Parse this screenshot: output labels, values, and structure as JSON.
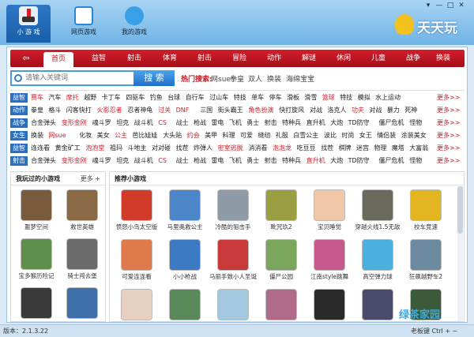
{
  "titlebar": {
    "tabs": [
      {
        "label": "小 游 戏",
        "icon": "joystick-icon",
        "color": "#2c77c4"
      },
      {
        "label": "网页游戏",
        "icon": "tv-icon",
        "color": "#ffffff"
      },
      {
        "label": "我的游戏",
        "icon": "user-icon",
        "color": "#ffffff"
      }
    ],
    "logo_text": "天天玩",
    "win_buttons": [
      "▾",
      "—",
      "□",
      "✕"
    ]
  },
  "nav": {
    "back_label": "⇦",
    "items": [
      "首页",
      "益智",
      "射击",
      "体育",
      "射击",
      "冒险",
      "动作",
      "解谜",
      "休闲",
      "儿童",
      "战争",
      "换装"
    ]
  },
  "search": {
    "placeholder": "请输入关键词",
    "button_label": "搜 索",
    "hot_label": "热门搜索:",
    "hot_words": [
      "网sue",
      "拳皇",
      "双人",
      "换装",
      "海绵宝宝"
    ]
  },
  "categories": [
    {
      "head": "益智",
      "items": [
        [
          "赛车",
          "r"
        ],
        [
          "汽车",
          ""
        ],
        [
          "摩托",
          "r"
        ],
        [
          "越野",
          ""
        ],
        [
          "卡丁车",
          ""
        ],
        [
          "四驱车",
          ""
        ],
        [
          "钓鱼",
          ""
        ],
        [
          "台球",
          ""
        ],
        [
          "自行车",
          ""
        ],
        [
          "过山车",
          ""
        ],
        [
          "特技",
          ""
        ],
        [
          "单车",
          ""
        ],
        [
          "停车",
          ""
        ],
        [
          "滑板",
          ""
        ],
        [
          "滑雪",
          ""
        ],
        [
          "篮球",
          "r"
        ],
        [
          "特技",
          ""
        ],
        [
          "模拟",
          ""
        ],
        [
          "水上运动",
          ""
        ]
      ]
    },
    {
      "head": "动作",
      "items": [
        [
          "拳皇",
          ""
        ],
        [
          "格斗",
          ""
        ],
        [
          "闪客快打",
          ""
        ],
        [
          "火影忍者",
          "r"
        ],
        [
          "忍者神龟",
          ""
        ],
        [
          "过关",
          "r"
        ],
        [
          "DNF",
          "r"
        ],
        [
          "三国",
          ""
        ],
        [
          "街头霸王",
          ""
        ],
        [
          "角色扮演",
          "r"
        ],
        [
          "快打旋风",
          ""
        ],
        [
          "对战",
          ""
        ],
        [
          "洛克人",
          ""
        ],
        [
          "功夫",
          "r"
        ],
        [
          "对战",
          ""
        ],
        [
          "暴力",
          ""
        ],
        [
          "死神",
          ""
        ],
        [
          "英雄",
          ""
        ]
      ]
    },
    {
      "head": "战争",
      "items": [
        [
          "合金弹头",
          ""
        ],
        [
          "变形金刚",
          "r"
        ],
        [
          "魂斗罗",
          ""
        ],
        [
          "坦克",
          ""
        ],
        [
          "战斗机",
          ""
        ],
        [
          "CS",
          "r"
        ],
        [
          "战士",
          ""
        ],
        [
          "枪战",
          ""
        ],
        [
          "雷电",
          ""
        ],
        [
          "飞机",
          ""
        ],
        [
          "勇士",
          ""
        ],
        [
          "射击",
          ""
        ],
        [
          "特种兵",
          ""
        ],
        [
          "直升机",
          ""
        ],
        [
          "大炮",
          ""
        ],
        [
          "TD防守",
          ""
        ],
        [
          "僵尸危机",
          ""
        ],
        [
          "怪物",
          ""
        ],
        [
          "策略",
          ""
        ]
      ]
    },
    {
      "head": "女生",
      "items": [
        [
          "换装",
          ""
        ],
        [
          "网sue",
          "r"
        ],
        [
          "化妆",
          ""
        ],
        [
          "美女",
          ""
        ],
        [
          "公主",
          "r"
        ],
        [
          "芭比娃娃",
          ""
        ],
        [
          "大头贴",
          ""
        ],
        [
          "约会",
          "r"
        ],
        [
          "美甲",
          ""
        ],
        [
          "料理",
          ""
        ],
        [
          "可爱",
          ""
        ],
        [
          "缝纫",
          ""
        ],
        [
          "礼服",
          ""
        ],
        [
          "白雪公主",
          ""
        ],
        [
          "波比",
          ""
        ],
        [
          "时尚",
          ""
        ],
        [
          "女王",
          ""
        ],
        [
          "情侣装",
          ""
        ],
        [
          "涂装美女",
          ""
        ]
      ]
    },
    {
      "head": "益智",
      "items": [
        [
          "连连看",
          ""
        ],
        [
          "黄金矿工",
          ""
        ],
        [
          "泡泡堂",
          "r"
        ],
        [
          "祖玛",
          ""
        ],
        [
          "斗地主",
          ""
        ],
        [
          "对对碰",
          ""
        ],
        [
          "找茬",
          ""
        ],
        [
          "炸弹人",
          ""
        ],
        [
          "密室逃脱",
          "r"
        ],
        [
          "消消看",
          ""
        ],
        [
          "泡泡龙",
          "r"
        ],
        [
          "吃豆豆",
          ""
        ],
        [
          "找茬",
          ""
        ],
        [
          "棋牌",
          ""
        ],
        [
          "迷宫",
          ""
        ],
        [
          "物理",
          ""
        ],
        [
          "魔塔",
          ""
        ],
        [
          "大富翁",
          ""
        ]
      ]
    },
    {
      "head": "射击",
      "items": [
        [
          "合金弹头",
          ""
        ],
        [
          "变形金刚",
          "r"
        ],
        [
          "魂斗罗",
          ""
        ],
        [
          "坦克",
          ""
        ],
        [
          "战斗机",
          ""
        ],
        [
          "CS",
          "r"
        ],
        [
          "战士",
          ""
        ],
        [
          "枪战",
          ""
        ],
        [
          "雷电",
          ""
        ],
        [
          "飞机",
          ""
        ],
        [
          "勇士",
          ""
        ],
        [
          "射击",
          ""
        ],
        [
          "特种兵",
          ""
        ],
        [
          "直升机",
          "r"
        ],
        [
          "大炮",
          ""
        ],
        [
          "TD防守",
          ""
        ],
        [
          "僵尸危机",
          ""
        ],
        [
          "怪物",
          ""
        ],
        [
          "策略",
          ""
        ]
      ]
    }
  ],
  "more_label": "更多>>",
  "played": {
    "title": "我玩过的小游戏",
    "more": "更多 +",
    "games": [
      {
        "name": "噩梦空间",
        "color": "#7a5a3c"
      },
      {
        "name": "救世英雄",
        "color": "#8a6a44"
      },
      {
        "name": "宝多猴历险记",
        "color": "#5f8f4c"
      },
      {
        "name": "骑士闯去堡",
        "color": "#6b6b6b"
      },
      {
        "name": "",
        "color": "#3a3a3a"
      },
      {
        "name": "",
        "color": "#3d6fa8"
      }
    ]
  },
  "recommend": {
    "title": "推荐小游戏",
    "games": [
      {
        "name": "愤怒小鸟太空版",
        "color": "#d23a2a"
      },
      {
        "name": "马里奥救公主",
        "color": "#4a86c8"
      },
      {
        "name": "冷酷的狙击手",
        "color": "#8e9aa6"
      },
      {
        "name": "毗咒玖2",
        "color": "#9aa042"
      },
      {
        "name": "宝贝睡觉",
        "color": "#f0c8a8"
      },
      {
        "name": "穿越火线1.5无敌",
        "color": "#6a6a5c"
      },
      {
        "name": "校车竞速",
        "color": "#e2b420"
      },
      {
        "name": "可爱连连看",
        "color": "#e07a4a"
      },
      {
        "name": "小小枪战",
        "color": "#3c7ac4"
      },
      {
        "name": "马丽手致小人圣诞",
        "color": "#c83a3a"
      },
      {
        "name": "僵尸公园",
        "color": "#7aa65c"
      },
      {
        "name": "江南style跳舞",
        "color": "#c65a8c"
      },
      {
        "name": "高空弹力球",
        "color": "#4ab0e0"
      },
      {
        "name": "狂飙越野车2",
        "color": "#6c8aa0"
      },
      {
        "name": "",
        "color": "#e8d0c0"
      },
      {
        "name": "",
        "color": "#5a8a5a"
      },
      {
        "name": "",
        "color": "#a4c8e0"
      },
      {
        "name": "",
        "color": "#b06a8a"
      },
      {
        "name": "",
        "color": "#2a2a2a"
      },
      {
        "name": "",
        "color": "#4a4a6a"
      },
      {
        "name": "",
        "color": "#3a5a3a"
      }
    ]
  },
  "status": {
    "version": "版本：2.1.3.22",
    "boss_key": "老板键 Ctrl + ~",
    "watermark": "绿茶家园"
  }
}
